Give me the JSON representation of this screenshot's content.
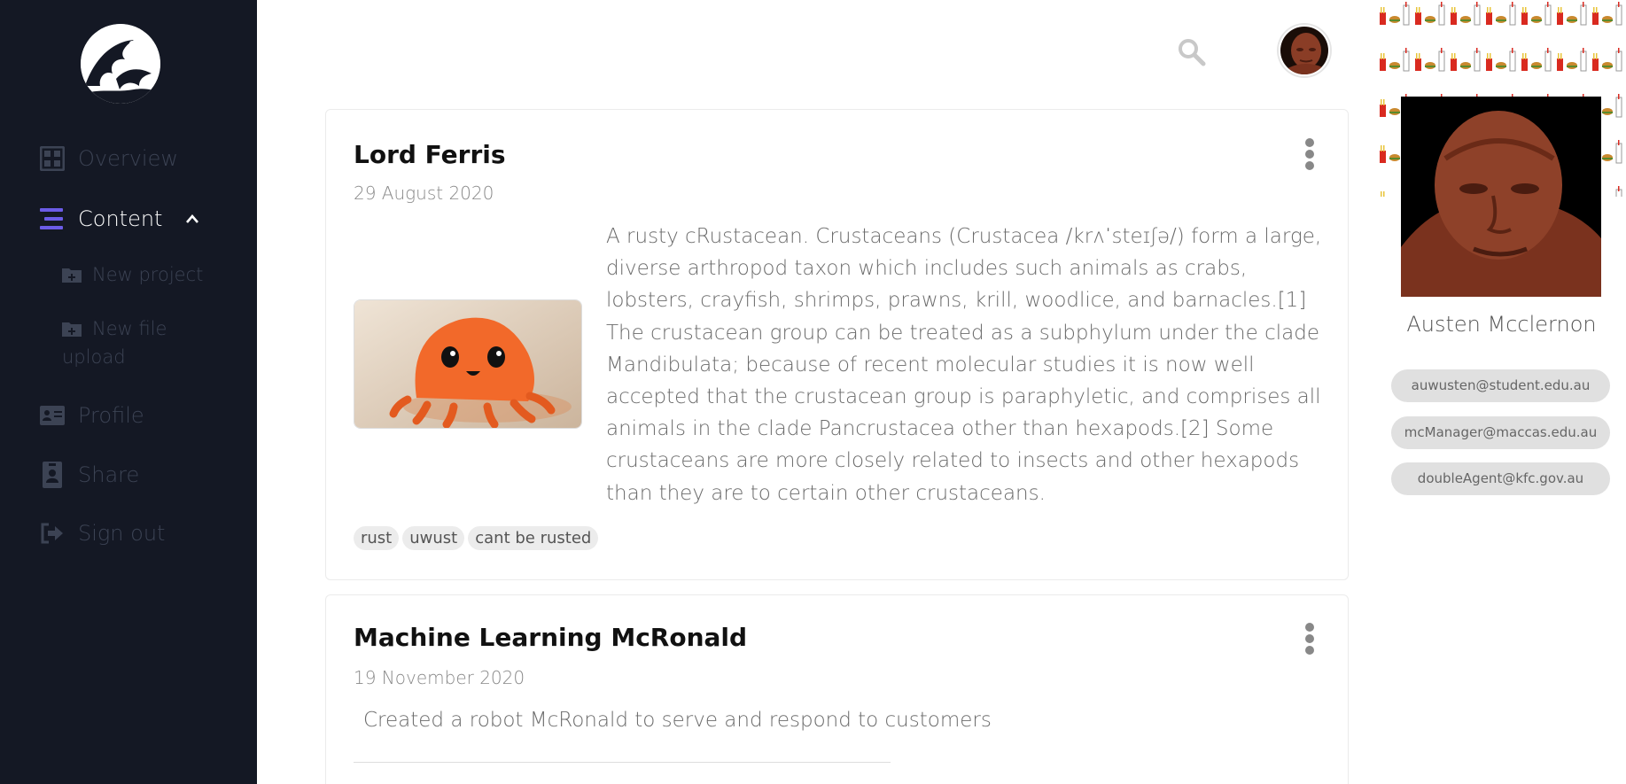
{
  "sidebar": {
    "nav": {
      "overview": "Overview",
      "content": "Content",
      "new_project": "New project",
      "new_file_upload": "New file upload",
      "profile": "Profile",
      "share": "Share",
      "sign_out": "Sign out"
    },
    "active_color": "#6b5ce7"
  },
  "topbar": {
    "search_icon": "search-icon",
    "avatar": "user-avatar"
  },
  "posts": [
    {
      "title": "Lord Ferris",
      "date": "29 August 2020",
      "body": "A rusty cRustacean. Crustaceans (Crustacea /krʌˈsteɪʃə/) form a large, diverse arthropod taxon which includes such animals as crabs, lobsters, crayfish, shrimps, prawns, krill, woodlice, and barnacles.[1] The crustacean group can be treated as a subphylum under the clade Mandibulata; because of recent molecular studies it is now well accepted that the crustacean group is paraphyletic, and comprises all animals in the clade Pancrustacea other than hexapods.[2] Some crustaceans are more closely related to insects and other hexapods than they are to certain other crustaceans.",
      "tags": [
        "rust",
        "uwust",
        "cant be rusted"
      ]
    },
    {
      "title": "Machine Learning McRonald",
      "date": "19 November 2020",
      "body": "Created a robot McRonald to serve and respond to customers"
    }
  ],
  "profile": {
    "name": "Austen Mcclernon",
    "emails": [
      "auwusten@student.edu.au",
      "mcManager@maccas.edu.au",
      "doubleAgent@kfc.gov.au"
    ]
  }
}
